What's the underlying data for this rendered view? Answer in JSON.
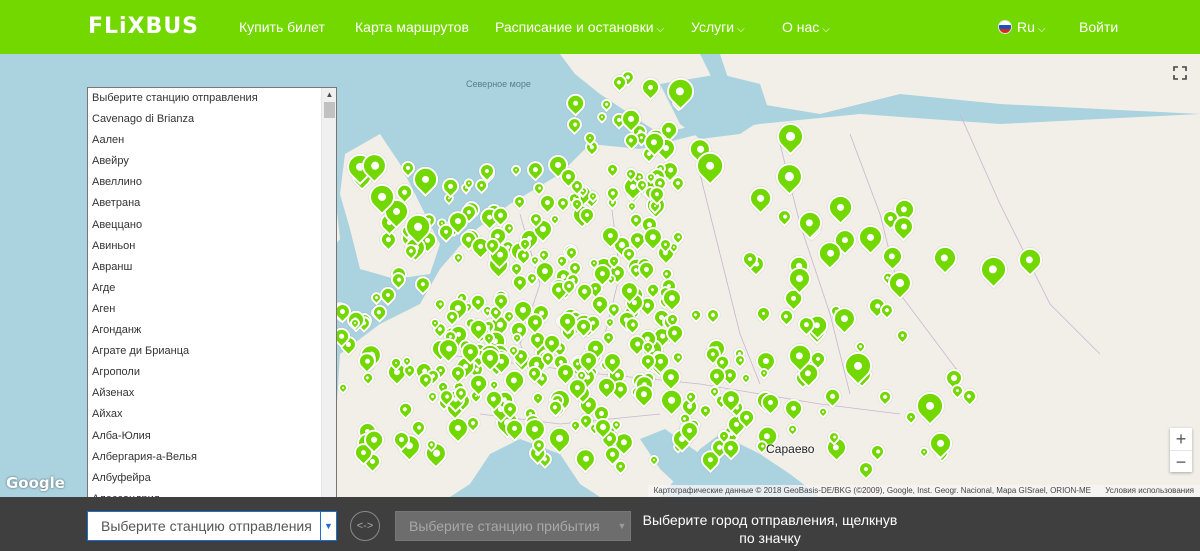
{
  "header": {
    "logo": "FLiXBUS",
    "nav": [
      {
        "label": "Купить билет"
      },
      {
        "label": "Карта маршрутов"
      },
      {
        "label": "Расписание и остановки"
      },
      {
        "label": "Услуги"
      },
      {
        "label": "О нас"
      }
    ],
    "lang": "Ru",
    "login": "Войти"
  },
  "map": {
    "sea_label": "Северное море",
    "city_label": "Сараево",
    "zoom_in": "+",
    "zoom_out": "−",
    "google": "Google",
    "attribution": "Картографические данные © 2018 GeoBasis-DE/BKG (©2009), Google, Inst. Geogr. Nacional, Mapa GISrael, ORION-ME",
    "terms": "Условия использования",
    "pin_color": "#73d700"
  },
  "dropdown": {
    "items": [
      "Выберите станцию отправления",
      "Cavenago di Brianza",
      "Аален",
      "Авейру",
      "Авеллино",
      "Аветрана",
      "Авеццано",
      "Авиньон",
      "Авранш",
      "Агде",
      "Аген",
      "Агонданж",
      "Аграте ди Брианца",
      "Агрополи",
      "Айзенах",
      "Айхах",
      "Алба-Юлия",
      "Албергария-а-Велья",
      "Албуфейра",
      "Алессандрия"
    ]
  },
  "bottom": {
    "from_placeholder": "Выберите станцию отправления",
    "swap": "<->",
    "to_placeholder": "Выберите станцию прибытия",
    "hint": "Выберите город отправления, щелкнув по значку"
  },
  "colors": {
    "brand": "#73d700",
    "bottom_bar": "#3f3f3f",
    "water": "#aad3df",
    "land": "#f2efe9"
  }
}
